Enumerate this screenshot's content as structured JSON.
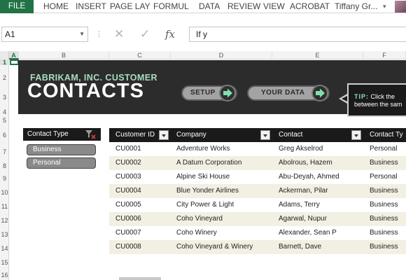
{
  "ribbon": {
    "file": "FILE",
    "tabs": [
      "HOME",
      "INSERT",
      "PAGE LAY",
      "FORMUL",
      "DATA",
      "REVIEW",
      "VIEW",
      "ACROBAT"
    ],
    "user": "Tiffany Gr..."
  },
  "formula_bar": {
    "name_box": "A1",
    "fx_label": "fx",
    "formula": "If y"
  },
  "columns": [
    "A",
    "B",
    "C",
    "D",
    "E",
    "F"
  ],
  "rows": [
    "1",
    "2",
    "3",
    "4",
    "5",
    "6",
    "7",
    "8",
    "9",
    "10",
    "11",
    "12",
    "13",
    "14",
    "15",
    "16"
  ],
  "banner": {
    "subtitle": "FABRIKAM, INC. CUSTOMER",
    "title": "CONTACTS",
    "setup_label": "SETUP",
    "your_data_label": "YOUR DATA",
    "tip_label": "TIP:",
    "tip_line1": "Click the",
    "tip_line2": "between the sam"
  },
  "slicer": {
    "header": "Contact Type",
    "items": [
      "Business",
      "Personal"
    ]
  },
  "table": {
    "headers": [
      "Customer ID",
      "Company",
      "Contact",
      "Contact Ty"
    ],
    "rows": [
      [
        "CU0001",
        "Adventure Works",
        "Greg Akselrod",
        "Personal"
      ],
      [
        "CU0002",
        "A Datum Corporation",
        "Abolrous, Hazem",
        "Business"
      ],
      [
        "CU0003",
        "Alpine Ski House",
        "Abu-Deyah, Ahmed",
        "Personal"
      ],
      [
        "CU0004",
        "Blue Yonder Airlines",
        "Ackerman, Pilar",
        "Business"
      ],
      [
        "CU0005",
        "City Power & Light",
        "Adams, Terry",
        "Business"
      ],
      [
        "CU0006",
        "Coho Vineyard",
        "Agarwal, Nupur",
        "Business"
      ],
      [
        "CU0007",
        "Coho Winery",
        "Alexander, Sean P",
        "Business"
      ],
      [
        "CU0008",
        "Coho Vineyard & Winery",
        "Barnett, Dave",
        "Business"
      ]
    ]
  },
  "colors": {
    "excel_green": "#217346",
    "banner_bg": "#2c2c2c",
    "subtitle_green": "#a8ddc1",
    "row_band": "#f2efe3"
  }
}
